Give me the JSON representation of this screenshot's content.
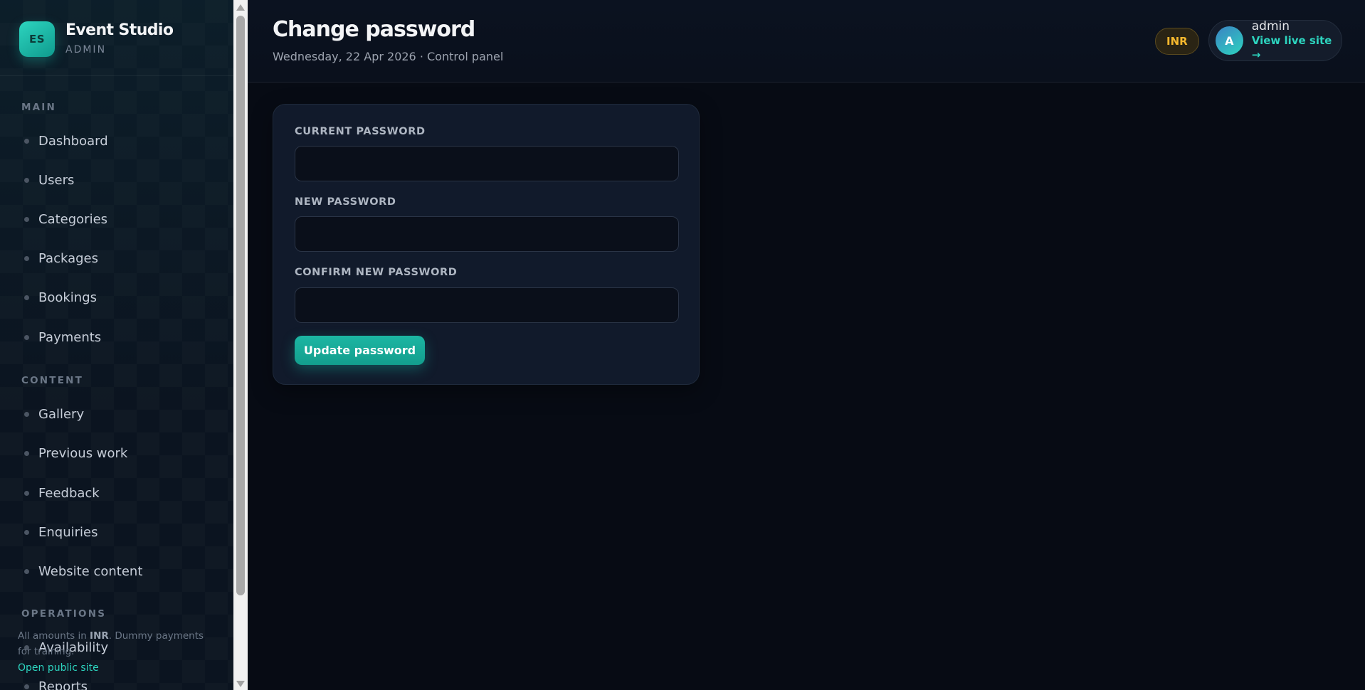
{
  "brand": {
    "logo_initials": "ES",
    "name": "Event Studio",
    "subtitle": "ADMIN"
  },
  "sidebar": {
    "sections": [
      {
        "title": "MAIN",
        "items": [
          {
            "label": "Dashboard"
          },
          {
            "label": "Users"
          },
          {
            "label": "Categories"
          },
          {
            "label": "Packages"
          },
          {
            "label": "Bookings"
          },
          {
            "label": "Payments"
          }
        ]
      },
      {
        "title": "CONTENT",
        "items": [
          {
            "label": "Gallery"
          },
          {
            "label": "Previous work"
          },
          {
            "label": "Feedback"
          },
          {
            "label": "Enquiries"
          },
          {
            "label": "Website content"
          }
        ]
      },
      {
        "title": "OPERATIONS",
        "items": [
          {
            "label": "Availability"
          },
          {
            "label": "Reports"
          }
        ]
      }
    ],
    "footer": {
      "note_prefix": "All amounts in ",
      "note_currency": "INR",
      "note_suffix": ". Dummy payments for training.",
      "link": "Open public site"
    }
  },
  "header": {
    "title": "Change password",
    "subtitle": "Wednesday, 22 Apr 2026 · Control panel",
    "currency_badge": "INR",
    "user": {
      "avatar_initial": "A",
      "name": "admin",
      "link": "View live site →"
    }
  },
  "form": {
    "fields": [
      {
        "label": "CURRENT PASSWORD",
        "value": ""
      },
      {
        "label": "NEW PASSWORD",
        "value": ""
      },
      {
        "label": "CONFIRM NEW PASSWORD",
        "value": ""
      }
    ],
    "submit_label": "Update password"
  },
  "colors": {
    "accent": "#2dd4bf",
    "button": "#1cb6a3",
    "badge_text": "#f5b82e",
    "background": "#070b14",
    "card": "#111a2b"
  }
}
